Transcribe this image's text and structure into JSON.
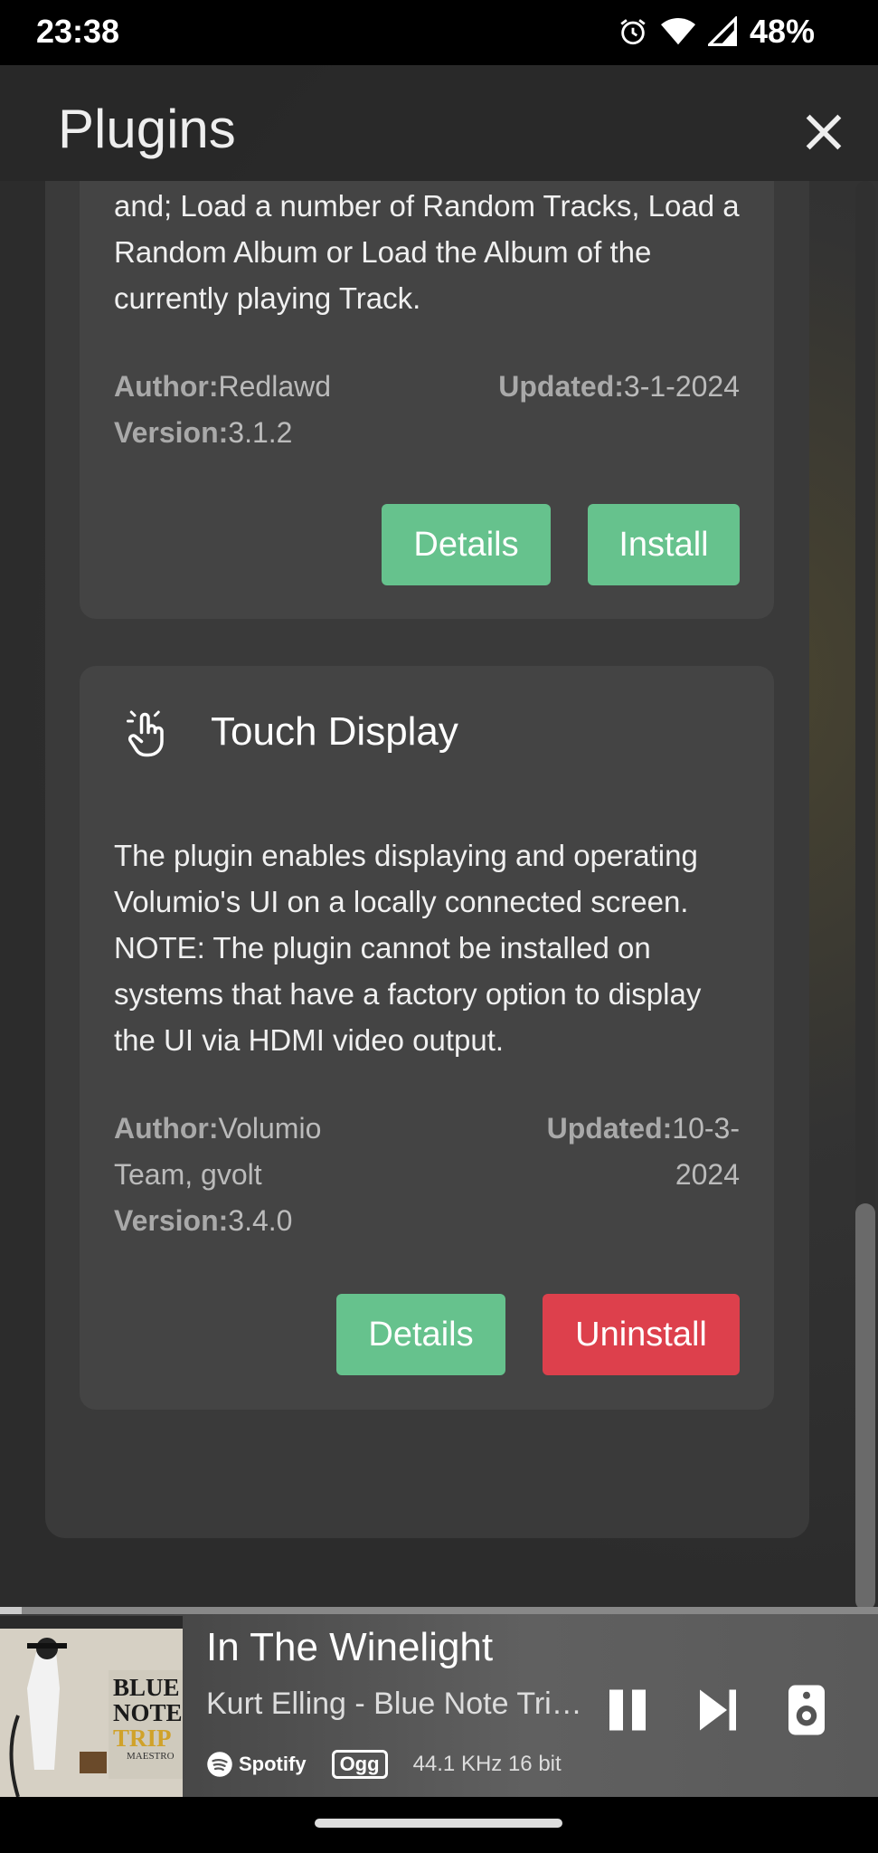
{
  "status_bar": {
    "time": "23:38",
    "battery": "48%"
  },
  "header": {
    "title": "Plugins"
  },
  "plugins": [
    {
      "description": "and; Load a number of Random Tracks, Load a Random Album or Load the Album of the currently playing Track.",
      "author_label": "Author:",
      "author": "Redlawd",
      "updated_label": "Updated:",
      "updated": "3-1-2024",
      "version_label": "Version:",
      "version": "3.1.2",
      "details_label": "Details",
      "action_label": "Install"
    },
    {
      "name": "Touch Display",
      "icon": "hand-pointer-icon",
      "description": "The plugin enables displaying and operating Volumio's UI on a locally connected screen. NOTE: The plugin cannot be installed on systems that have a factory option to display the UI via HDMI video output.",
      "author_label": "Author:",
      "author": "Volumio Team, gvolt",
      "updated_label": "Updated:",
      "updated": "10-3-2024",
      "version_label": "Version:",
      "version": "3.4.0",
      "details_label": "Details",
      "action_label": "Uninstall"
    }
  ],
  "player": {
    "track_title": "In The Winelight",
    "artist_album": "Kurt Elling - Blue Note Trip Maestro",
    "source": "Spotify",
    "format": "Ogg",
    "quality": "44.1 KHz 16 bit",
    "album_art_text": [
      "BLUE",
      "NOTE",
      "TRIP",
      "MAESTRO"
    ]
  },
  "colors": {
    "install": "#66c28d",
    "uninstall": "#dd404c"
  }
}
